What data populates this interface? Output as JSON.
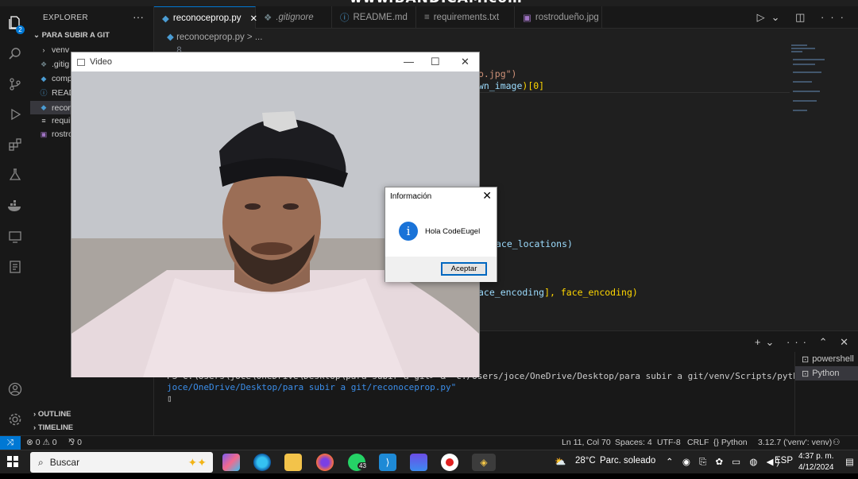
{
  "banner": "www.BANDICAM.com",
  "explorer": {
    "title": "EXPLORER",
    "more": "···",
    "folder": "PARA SUBIR A GIT",
    "items": [
      {
        "label": "venv",
        "icon": "chevron-right"
      },
      {
        "label": ".gitig",
        "icon": "gear"
      },
      {
        "label": "comp",
        "icon": "python-file"
      },
      {
        "label": "READ",
        "icon": "info"
      },
      {
        "label": "recon",
        "icon": "python-file"
      },
      {
        "label": "requi",
        "icon": "text-file"
      },
      {
        "label": "rostro",
        "icon": "image-file"
      }
    ],
    "outline": "OUTLINE",
    "timeline": "TIMELINE"
  },
  "activity_badge": "2",
  "tabs": [
    {
      "label": "reconoceprop.py",
      "icon": "python-file",
      "active": true,
      "close": "✕"
    },
    {
      "label": ".gitignore",
      "icon": "gear",
      "active": false
    },
    {
      "label": "README.md",
      "icon": "info",
      "active": false,
      "modified": true
    },
    {
      "label": "requirements.txt",
      "icon": "text-file",
      "active": false,
      "modified": true
    },
    {
      "label": "rostrodueño.jpg",
      "icon": "image-file",
      "active": false
    }
  ],
  "breadcrumb": "reconoceprop.py > ...",
  "code": {
    "line_num": "8",
    "l1_str": "o.jpg\")",
    "l2_a": "wn_image",
    "l2_b": ")[0]",
    "l3": "ace_locations)",
    "l4_a": "ace_encoding",
    "l4_b": "], face_encoding)"
  },
  "terminal": {
    "line1": "PS C:\\Users\\joce\\OneDrive\\Desktop\\para subir a git> & \"c:/Users/joce/OneDrive/Desktop/para subir a git/venv/Scripts/python.exe\" \"c:/Users/",
    "line2": "joce/OneDrive/Desktop/para subir a git/reconoceprop.py\"",
    "cursor": "▯",
    "shells": [
      "powershell",
      "Python"
    ]
  },
  "status": {
    "errors": "⊗ 0 ⚠ 0",
    "ports": "⅋ 0",
    "position": "Ln 11, Col 70",
    "spaces": "Spaces: 4",
    "encoding": "UTF-8",
    "eol": "CRLF",
    "language": "{} Python",
    "interpreter": "3.12.7 ('venv': venv)"
  },
  "video_window": {
    "title": "Video",
    "minimize": "—",
    "maximize": "☐",
    "close": "✕"
  },
  "dialog": {
    "title": "Información",
    "message": "Hola CodeEugel",
    "button": "Aceptar",
    "info_glyph": "i",
    "close": "✕"
  },
  "taskbar": {
    "search": "Buscar",
    "weather_temp": "28°C",
    "weather_desc": "Parc. soleado",
    "lang": "ESP",
    "time": "4:37 p. m.",
    "date": "4/12/2024",
    "whatsapp_badge": "43"
  },
  "colors": {
    "accent": "#0078d4",
    "editor_bg": "#1f1f1f",
    "side_bg": "#181818",
    "dialog_icon": "#1a73d8"
  }
}
